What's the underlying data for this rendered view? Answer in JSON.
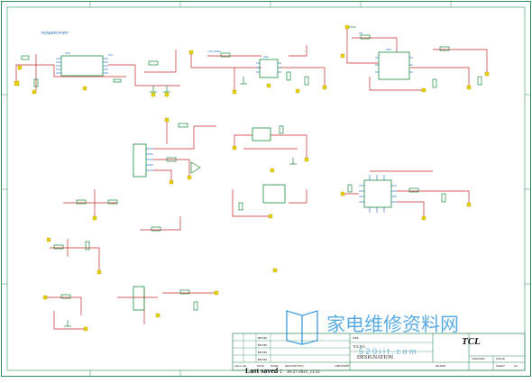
{
  "sheet": {
    "section_title": "POWER PART"
  },
  "title_block": {
    "company": "TCL",
    "size_label": "SIZE",
    "size_value": "A3",
    "tcl_no_label": "TCLNO:",
    "designation_label": "DESIGNATION",
    "last_saved_label": "Last saved :",
    "last_saved_value": "10-27-2011_11:32",
    "last_modif_label": "Last modif",
    "revision_headers": [
      "Index Lab",
      "DATE",
      "NAME",
      "DESCRIPTION"
    ],
    "revision_rows": [
      "BB-MM",
      "BB-MM",
      "BB-MM",
      "BB-MM"
    ],
    "checked_label": "CHECKED",
    "drawn_label": "DRAWN",
    "scale_label": "SCALE",
    "sheet_label": "SHEET"
  },
  "watermark": {
    "text": "家电维修资料网",
    "url": "5 2 0 i i t . c o m"
  },
  "colors": {
    "border": "#2e8b57",
    "wire": "#c62828",
    "component": "#1a8a3a",
    "junction": "#e8d200",
    "pin": "#1565c0",
    "text": "#222222",
    "watermark": "#4aa3df"
  }
}
